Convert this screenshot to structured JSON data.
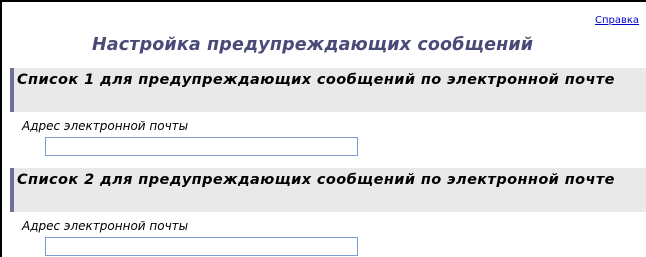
{
  "header": {
    "help_link": "Справка",
    "title": "Настройка предупреждающих сообщений"
  },
  "sections": [
    {
      "title": "Список 1 для предупреждающих сообщений по электронной почте",
      "field_label": "Адрес электронной почты",
      "field_value": ""
    },
    {
      "title": "Список 2 для предупреждающих сообщений по электронной почте",
      "field_label": "Адрес электронной почты",
      "field_value": ""
    }
  ]
}
